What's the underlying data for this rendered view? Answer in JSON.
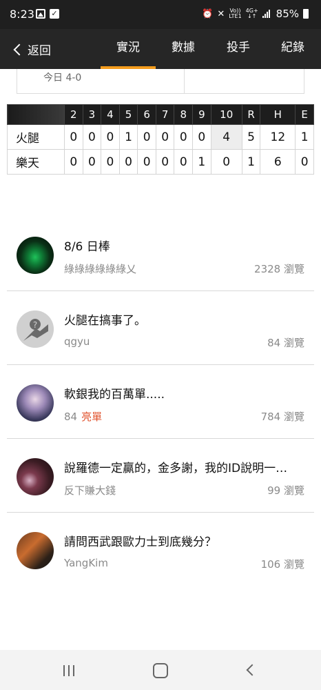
{
  "status_bar": {
    "time": "8:23",
    "battery": "85%",
    "volte": "Vo))",
    "lte": "LTE1",
    "network": "4G+",
    "icons": [
      "image-icon",
      "check-icon",
      "alarm-icon",
      "mute-icon",
      "volte-icon",
      "network-icon",
      "signal-icon",
      "battery-icon"
    ]
  },
  "header": {
    "back_label": "返回",
    "tabs": [
      {
        "label": "實況",
        "active": true
      },
      {
        "label": "數據",
        "active": false
      },
      {
        "label": "投手",
        "active": false
      },
      {
        "label": "紀錄",
        "active": false
      }
    ],
    "accent_color": "#f39c1d"
  },
  "prev_card": {
    "text": "今日 4-0"
  },
  "scoreboard": {
    "columns": [
      "2",
      "3",
      "4",
      "5",
      "6",
      "7",
      "8",
      "9",
      "10",
      "R",
      "H",
      "E"
    ],
    "rows": [
      {
        "team": "火腿",
        "scores": [
          "0",
          "0",
          "0",
          "1",
          "0",
          "0",
          "0",
          "0",
          "4",
          "5",
          "12",
          "1"
        ]
      },
      {
        "team": "樂天",
        "scores": [
          "0",
          "0",
          "0",
          "0",
          "0",
          "0",
          "0",
          "1",
          "0",
          "1",
          "6",
          "0"
        ]
      }
    ]
  },
  "posts": [
    {
      "title": "8/6 日棒",
      "author": "綠綠綠綠綠綠乂",
      "views": "2328 瀏覽",
      "badge": ""
    },
    {
      "title": "火腿在搞事了。",
      "author": "qgyu",
      "views": "84 瀏覽",
      "badge": ""
    },
    {
      "title": "軟銀我的百萬單.....",
      "author": "84",
      "views": "784 瀏覽",
      "badge": "亮單"
    },
    {
      "title": "說羅德一定贏的，金多謝，我的ID說明一…",
      "author": "反下賺大錢",
      "views": "99 瀏覽",
      "badge": ""
    },
    {
      "title": "請問西武跟歐力士到底幾分？",
      "author": "YangKim",
      "views": "106 瀏覽",
      "badge": ""
    }
  ],
  "badge_color": "#e0522d"
}
